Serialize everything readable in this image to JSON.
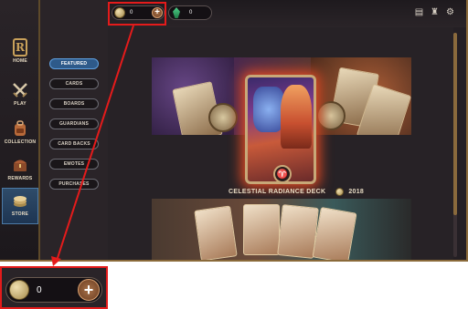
{
  "nav": {
    "items": [
      {
        "label": "HOME",
        "icon": "legends-logo-icon"
      },
      {
        "label": "PLAY",
        "icon": "crossed-swords-icon"
      },
      {
        "label": "COLLECTION",
        "icon": "backpack-icon"
      },
      {
        "label": "REWARDS",
        "icon": "treasure-chest-icon"
      },
      {
        "label": "STORE",
        "icon": "coin-stack-icon"
      }
    ],
    "active": "STORE"
  },
  "submenu": {
    "items": [
      "FEATURED",
      "CARDS",
      "BOARDS",
      "GUARDIANS",
      "CARD BACKS",
      "EMOTES",
      "PURCHASES"
    ],
    "active": "FEATURED"
  },
  "topbar": {
    "coins": "0",
    "shards": "0",
    "icons": [
      "missions-icon",
      "profile-icon",
      "settings-gear-icon"
    ]
  },
  "featured": {
    "deck_title": "CELESTIAL RADIANCE DECK",
    "deck_price": "2018"
  },
  "zoom": {
    "coins": "0"
  },
  "colors": {
    "highlight": "#e41b1b",
    "active_tab": "#2e5a8a",
    "glow": "#e24a24"
  }
}
